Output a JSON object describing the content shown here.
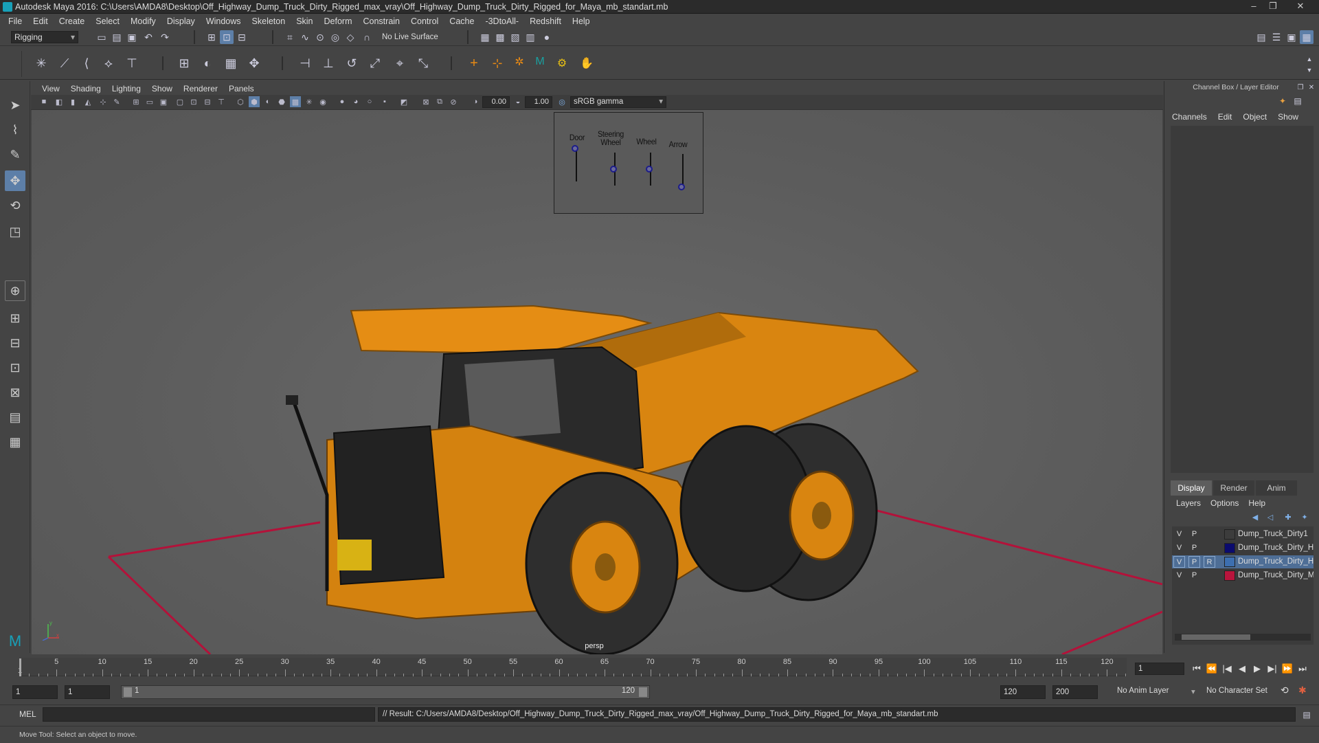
{
  "window": {
    "title": "Autodesk Maya 2016: C:\\Users\\AMDA8\\Desktop\\Off_Highway_Dump_Truck_Dirty_Rigged_max_vray\\Off_Highway_Dump_Truck_Dirty_Rigged_for_Maya_mb_standart.mb",
    "minimize": "–",
    "maximize": "❐",
    "close": "✕"
  },
  "menubar": [
    "File",
    "Edit",
    "Create",
    "Select",
    "Modify",
    "Display",
    "Windows",
    "Skeleton",
    "Skin",
    "Deform",
    "Constrain",
    "Control",
    "Cache",
    "-3DtoAll-",
    "Redshift",
    "Help"
  ],
  "statusline": {
    "mode": "Rigging",
    "live_surface": "No Live Surface"
  },
  "viewport": {
    "menus": [
      "View",
      "Shading",
      "Lighting",
      "Show",
      "Renderer",
      "Panels"
    ],
    "exposure": "0.00",
    "gamma": "1.00",
    "color_space": "sRGB gamma",
    "camera_label": "persp",
    "axis": {
      "y": "y",
      "x": "x"
    }
  },
  "control_board": {
    "sliders": [
      {
        "label": "Door",
        "value": 1.0
      },
      {
        "label": "Steering Wheel",
        "value": 0.5
      },
      {
        "label": "Wheel",
        "value": 0.5
      },
      {
        "label": "Arrow",
        "value": 0.0
      }
    ]
  },
  "channel_box": {
    "title": "Channel Box / Layer Editor",
    "tabs": [
      "Channels",
      "Edit",
      "Object",
      "Show"
    ]
  },
  "layer_editor": {
    "tabs": [
      "Display",
      "Render",
      "Anim"
    ],
    "active_tab": "Display",
    "menus": [
      "Layers",
      "Options",
      "Help"
    ],
    "layers": [
      {
        "v": "V",
        "p": "P",
        "r": "",
        "color": "#3c3c3c",
        "name": "Dump_Truck_Dirty1",
        "selected": false
      },
      {
        "v": "V",
        "p": "P",
        "r": "",
        "color": "#0b0b6e",
        "name": "Dump_Truck_Dirty_Hel",
        "selected": false
      },
      {
        "v": "V",
        "p": "P",
        "r": "R",
        "color": "#3d6fb0",
        "name": "Dump_Truck_Dirty_Hel",
        "selected": true
      },
      {
        "v": "V",
        "p": "P",
        "r": "",
        "color": "#b8143c",
        "name": "Dump_Truck_Dirty_Mai",
        "selected": false
      }
    ]
  },
  "timeslider": {
    "labels": [
      "5",
      "10",
      "15",
      "20",
      "25",
      "30",
      "35",
      "40",
      "45",
      "50",
      "55",
      "60",
      "65",
      "70",
      "75",
      "80",
      "85",
      "90",
      "95",
      "100",
      "105",
      "110",
      "115",
      "120"
    ],
    "start_label": "1",
    "current_frame": "1",
    "playback_buttons": [
      "⏮",
      "⏪",
      "|◀",
      "◀",
      "▶",
      "▶|",
      "⏩",
      "⏭"
    ]
  },
  "range": {
    "start": "1",
    "start2": "1",
    "slider_start": "1",
    "slider_end": "120",
    "end": "120",
    "anim_end": "200",
    "anim_layer": "No Anim Layer",
    "character_set": "No Character Set"
  },
  "commandline": {
    "label": "MEL",
    "result": "// Result: C:/Users/AMDA8/Desktop/Off_Highway_Dump_Truck_Dirty_Rigged_max_vray/Off_Highway_Dump_Truck_Dirty_Rigged_for_Maya_mb_standart.mb"
  },
  "helpline": "Move Tool: Select an object to move.",
  "colors": {
    "accent": "#4e6e96",
    "grid_red": "#b3123a",
    "truck_orange": "#e88a14"
  }
}
